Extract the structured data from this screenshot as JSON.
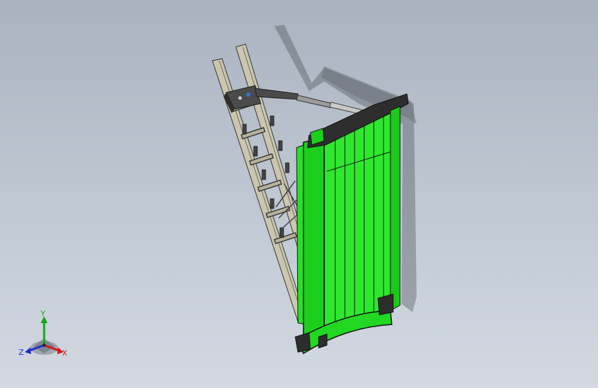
{
  "viewport": {
    "background_top": "#a9b3bf",
    "background_bottom": "#d3d9e1",
    "model_color_primary": "#27e027",
    "model_color_frame": "#cbc6b0",
    "model_color_actuator": "#7f7f7f"
  },
  "triad": {
    "x_label": "X",
    "y_label": "Y",
    "z_label": "Z",
    "x_color": "#d11a1a",
    "y_color": "#1aa51a",
    "z_color": "#1d2fcf"
  }
}
